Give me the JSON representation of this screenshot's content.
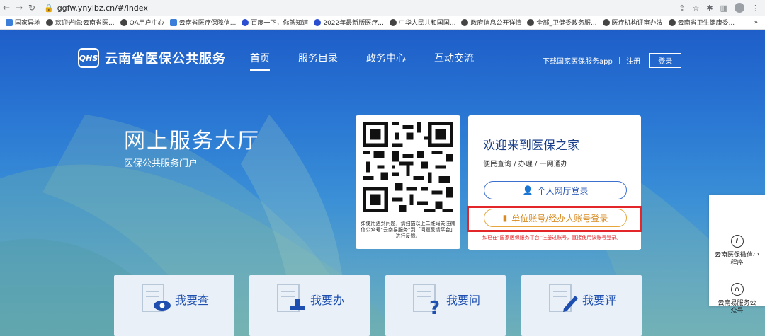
{
  "browser": {
    "url": "ggfw.ynylbz.cn/#/index",
    "bookmarks": [
      "国家异地",
      "欢迎光临:云南省医...",
      "OA用户中心",
      "云南省医疗保障信...",
      "百度一下，你就知道",
      "2022年最新版医疗...",
      "中华人民共和国国...",
      "政府信息公开详情",
      "全部_卫健委政务服...",
      "医疗机构评审办法",
      "云南省卫生健康委..."
    ],
    "more": "»"
  },
  "header": {
    "logo_badge": "QHS",
    "site_name": "云南省医保公共服务",
    "nav": [
      "首页",
      "服务目录",
      "政务中心",
      "互动交流"
    ],
    "download_app": "下载国家医保服务app",
    "separator": "|",
    "register": "注册",
    "login": "登录"
  },
  "hero": {
    "title": "网上服务大厅",
    "subtitle": "医保公共服务门户"
  },
  "qr_card": {
    "note": "如使用遇到问题，请扫描以上二维码关注微信公众号“云南易服务”到「问题反馈平台」进行反馈。"
  },
  "welcome": {
    "title": "欢迎来到医保之家",
    "subtitle": "便民查询 / 办理 / 一网通办",
    "personal_login": "个人网厅登录",
    "unit_login": "单位账号/经办人账号登录",
    "warning": "如已在“国家医保服务平台”注册过账号，直接使用该账号登录。"
  },
  "tiles": [
    "我要查",
    "我要办",
    "我要问",
    "我要评"
  ],
  "side_panel": {
    "mini_program": "云南医保微信小程序",
    "official_account": "云南易服务公众号"
  },
  "colors": {
    "accent": "#1e5ec9",
    "highlight": "#e2262a",
    "unit_orange": "#d88a20"
  }
}
